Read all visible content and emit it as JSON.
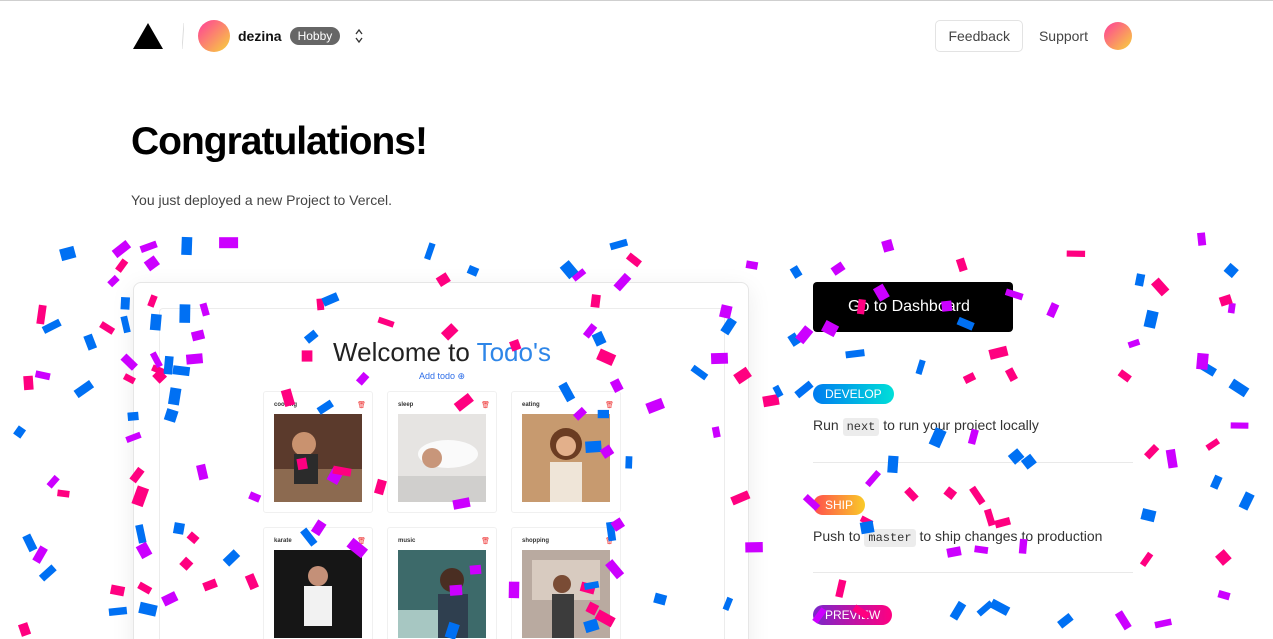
{
  "header": {
    "team_name": "dezina",
    "plan_badge": "Hobby",
    "feedback_label": "Feedback",
    "support_label": "Support"
  },
  "hero": {
    "title": "Congratulations!",
    "subtitle": "You just deployed a new Project to Vercel."
  },
  "preview": {
    "welcome_prefix": "Welcome to ",
    "welcome_accent": "Todo's",
    "add_todo": "Add todo ⊕",
    "todos": [
      {
        "label": "cooking"
      },
      {
        "label": "sleep"
      },
      {
        "label": "eating"
      },
      {
        "label": "karate"
      },
      {
        "label": "music"
      },
      {
        "label": "shopping"
      }
    ]
  },
  "actions": {
    "dashboard_label": "Go to Dashboard"
  },
  "steps": [
    {
      "tag": "DEVELOP",
      "before": "Run ",
      "code": "next",
      "after": " to run your project locally"
    },
    {
      "tag": "SHIP",
      "before": "Push to ",
      "code": "master",
      "after": " to ship changes to production"
    },
    {
      "tag": "PREVIEW"
    }
  ],
  "colors": {
    "accent_blue": "#2e86e8",
    "develop_gradient": [
      "#007cf0",
      "#00dfd8"
    ],
    "ship_gradient": [
      "#ff4d4d",
      "#f9cb28"
    ],
    "preview_gradient": [
      "#7928ca",
      "#ff0080"
    ],
    "confetti": [
      "#ff0080",
      "#0070f3",
      "#cc00ff"
    ]
  },
  "icons": {
    "logo": "vercel-triangle-icon",
    "chevron": "chevron-updown-icon",
    "edit": "pencil-icon",
    "trash": "trash-icon"
  }
}
